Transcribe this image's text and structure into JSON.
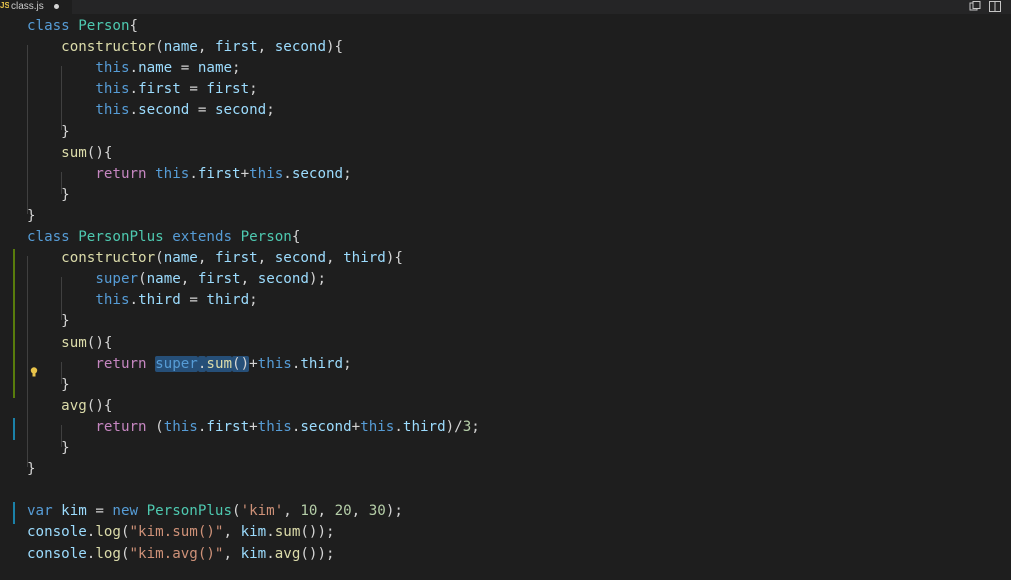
{
  "tab": {
    "lang_badge": "JS",
    "file_name": "class.js"
  },
  "editor_actions": [
    {
      "icon": "open-changes-icon"
    },
    {
      "icon": "split-editor-icon"
    }
  ],
  "theme": {
    "background": "#1e1e1e",
    "keyword": "#569cd6",
    "function": "#dcdcaa",
    "class": "#4ec9b0",
    "variable": "#9cdcfe",
    "string": "#ce9178",
    "number": "#b5cea8",
    "modified_gutter": "#587c0c",
    "selection": "#264f78"
  },
  "code_lines": [
    [
      [
        "kw",
        "class"
      ],
      [
        "pun",
        " "
      ],
      [
        "cls",
        "Person"
      ],
      [
        "pun",
        "{"
      ]
    ],
    [
      [
        "pun",
        "    "
      ],
      [
        "fn",
        "constructor"
      ],
      [
        "pun",
        "("
      ],
      [
        "var",
        "name"
      ],
      [
        "pun",
        ", "
      ],
      [
        "var",
        "first"
      ],
      [
        "pun",
        ", "
      ],
      [
        "var",
        "second"
      ],
      [
        "pun",
        "){"
      ]
    ],
    [
      [
        "pun",
        "        "
      ],
      [
        "kw",
        "this"
      ],
      [
        "pun",
        "."
      ],
      [
        "var",
        "name"
      ],
      [
        "pun",
        " = "
      ],
      [
        "var",
        "name"
      ],
      [
        "pun",
        ";"
      ]
    ],
    [
      [
        "pun",
        "        "
      ],
      [
        "kw",
        "this"
      ],
      [
        "pun",
        "."
      ],
      [
        "var",
        "first"
      ],
      [
        "pun",
        " = "
      ],
      [
        "var",
        "first"
      ],
      [
        "pun",
        ";"
      ]
    ],
    [
      [
        "pun",
        "        "
      ],
      [
        "kw",
        "this"
      ],
      [
        "pun",
        "."
      ],
      [
        "var",
        "second"
      ],
      [
        "pun",
        " = "
      ],
      [
        "var",
        "second"
      ],
      [
        "pun",
        ";"
      ]
    ],
    [
      [
        "pun",
        "    }"
      ]
    ],
    [
      [
        "pun",
        "    "
      ],
      [
        "fn",
        "sum"
      ],
      [
        "pun",
        "(){"
      ]
    ],
    [
      [
        "pun",
        "        "
      ],
      [
        "ctl",
        "return"
      ],
      [
        "pun",
        " "
      ],
      [
        "kw",
        "this"
      ],
      [
        "pun",
        "."
      ],
      [
        "var",
        "first"
      ],
      [
        "pun",
        "+"
      ],
      [
        "kw",
        "this"
      ],
      [
        "pun",
        "."
      ],
      [
        "var",
        "second"
      ],
      [
        "pun",
        ";"
      ]
    ],
    [
      [
        "pun",
        "    }"
      ]
    ],
    [
      [
        "pun",
        "}"
      ]
    ],
    [
      [
        "kw",
        "class"
      ],
      [
        "pun",
        " "
      ],
      [
        "cls",
        "PersonPlus"
      ],
      [
        "pun",
        " "
      ],
      [
        "kw",
        "extends"
      ],
      [
        "pun",
        " "
      ],
      [
        "cls",
        "Person"
      ],
      [
        "pun",
        "{"
      ]
    ],
    [
      [
        "pun",
        "    "
      ],
      [
        "fn",
        "constructor"
      ],
      [
        "pun",
        "("
      ],
      [
        "var",
        "name"
      ],
      [
        "pun",
        ", "
      ],
      [
        "var",
        "first"
      ],
      [
        "pun",
        ", "
      ],
      [
        "var",
        "second"
      ],
      [
        "pun",
        ", "
      ],
      [
        "var",
        "third"
      ],
      [
        "pun",
        "){"
      ]
    ],
    [
      [
        "pun",
        "        "
      ],
      [
        "kw",
        "super"
      ],
      [
        "pun",
        "("
      ],
      [
        "var",
        "name"
      ],
      [
        "pun",
        ", "
      ],
      [
        "var",
        "first"
      ],
      [
        "pun",
        ", "
      ],
      [
        "var",
        "second"
      ],
      [
        "pun",
        ");"
      ]
    ],
    [
      [
        "pun",
        "        "
      ],
      [
        "kw",
        "this"
      ],
      [
        "pun",
        "."
      ],
      [
        "var",
        "third"
      ],
      [
        "pun",
        " = "
      ],
      [
        "var",
        "third"
      ],
      [
        "pun",
        ";"
      ]
    ],
    [
      [
        "pun",
        "    }"
      ]
    ],
    [
      [
        "pun",
        "    "
      ],
      [
        "fn",
        "sum"
      ],
      [
        "pun",
        "(){"
      ]
    ],
    [
      [
        "pun",
        "        "
      ],
      [
        "ctl",
        "return"
      ],
      [
        "pun",
        " "
      ],
      [
        "kw",
        "super",
        "sel"
      ],
      [
        "pun",
        ".",
        "sel"
      ],
      [
        "fn",
        "sum",
        "sel"
      ],
      [
        "pun",
        "()",
        "sel"
      ],
      [
        "pun",
        "+"
      ],
      [
        "kw",
        "this"
      ],
      [
        "pun",
        "."
      ],
      [
        "var",
        "third"
      ],
      [
        "pun",
        ";"
      ]
    ],
    [
      [
        "pun",
        "    }"
      ]
    ],
    [
      [
        "pun",
        "    "
      ],
      [
        "fn",
        "avg"
      ],
      [
        "pun",
        "(){"
      ]
    ],
    [
      [
        "pun",
        "        "
      ],
      [
        "ctl",
        "return"
      ],
      [
        "pun",
        " ("
      ],
      [
        "kw",
        "this"
      ],
      [
        "pun",
        "."
      ],
      [
        "var",
        "first"
      ],
      [
        "pun",
        "+"
      ],
      [
        "kw",
        "this"
      ],
      [
        "pun",
        "."
      ],
      [
        "var",
        "second"
      ],
      [
        "pun",
        "+"
      ],
      [
        "kw",
        "this"
      ],
      [
        "pun",
        "."
      ],
      [
        "var",
        "third"
      ],
      [
        "pun",
        ")/"
      ],
      [
        "num",
        "3"
      ],
      [
        "pun",
        ";"
      ]
    ],
    [
      [
        "pun",
        "    }"
      ]
    ],
    [
      [
        "pun",
        "}"
      ]
    ],
    [
      [
        "pun",
        ""
      ]
    ],
    [
      [
        "kw",
        "var"
      ],
      [
        "pun",
        " "
      ],
      [
        "var",
        "kim"
      ],
      [
        "pun",
        " = "
      ],
      [
        "kw",
        "new"
      ],
      [
        "pun",
        " "
      ],
      [
        "cls",
        "PersonPlus"
      ],
      [
        "pun",
        "("
      ],
      [
        "str",
        "'kim'"
      ],
      [
        "pun",
        ", "
      ],
      [
        "num",
        "10"
      ],
      [
        "pun",
        ", "
      ],
      [
        "num",
        "20"
      ],
      [
        "pun",
        ", "
      ],
      [
        "num",
        "30"
      ],
      [
        "pun",
        ");"
      ]
    ],
    [
      [
        "var",
        "console"
      ],
      [
        "pun",
        "."
      ],
      [
        "fn",
        "log"
      ],
      [
        "pun",
        "("
      ],
      [
        "str",
        "\"kim.sum()\""
      ],
      [
        "pun",
        ", "
      ],
      [
        "var",
        "kim"
      ],
      [
        "pun",
        "."
      ],
      [
        "fn",
        "sum"
      ],
      [
        "pun",
        "());"
      ]
    ],
    [
      [
        "var",
        "console"
      ],
      [
        "pun",
        "."
      ],
      [
        "fn",
        "log"
      ],
      [
        "pun",
        "("
      ],
      [
        "str",
        "\"kim.avg()\""
      ],
      [
        "pun",
        ", "
      ],
      [
        "var",
        "kim"
      ],
      [
        "pun",
        "."
      ],
      [
        "fn",
        "avg"
      ],
      [
        "pun",
        "());"
      ]
    ]
  ]
}
